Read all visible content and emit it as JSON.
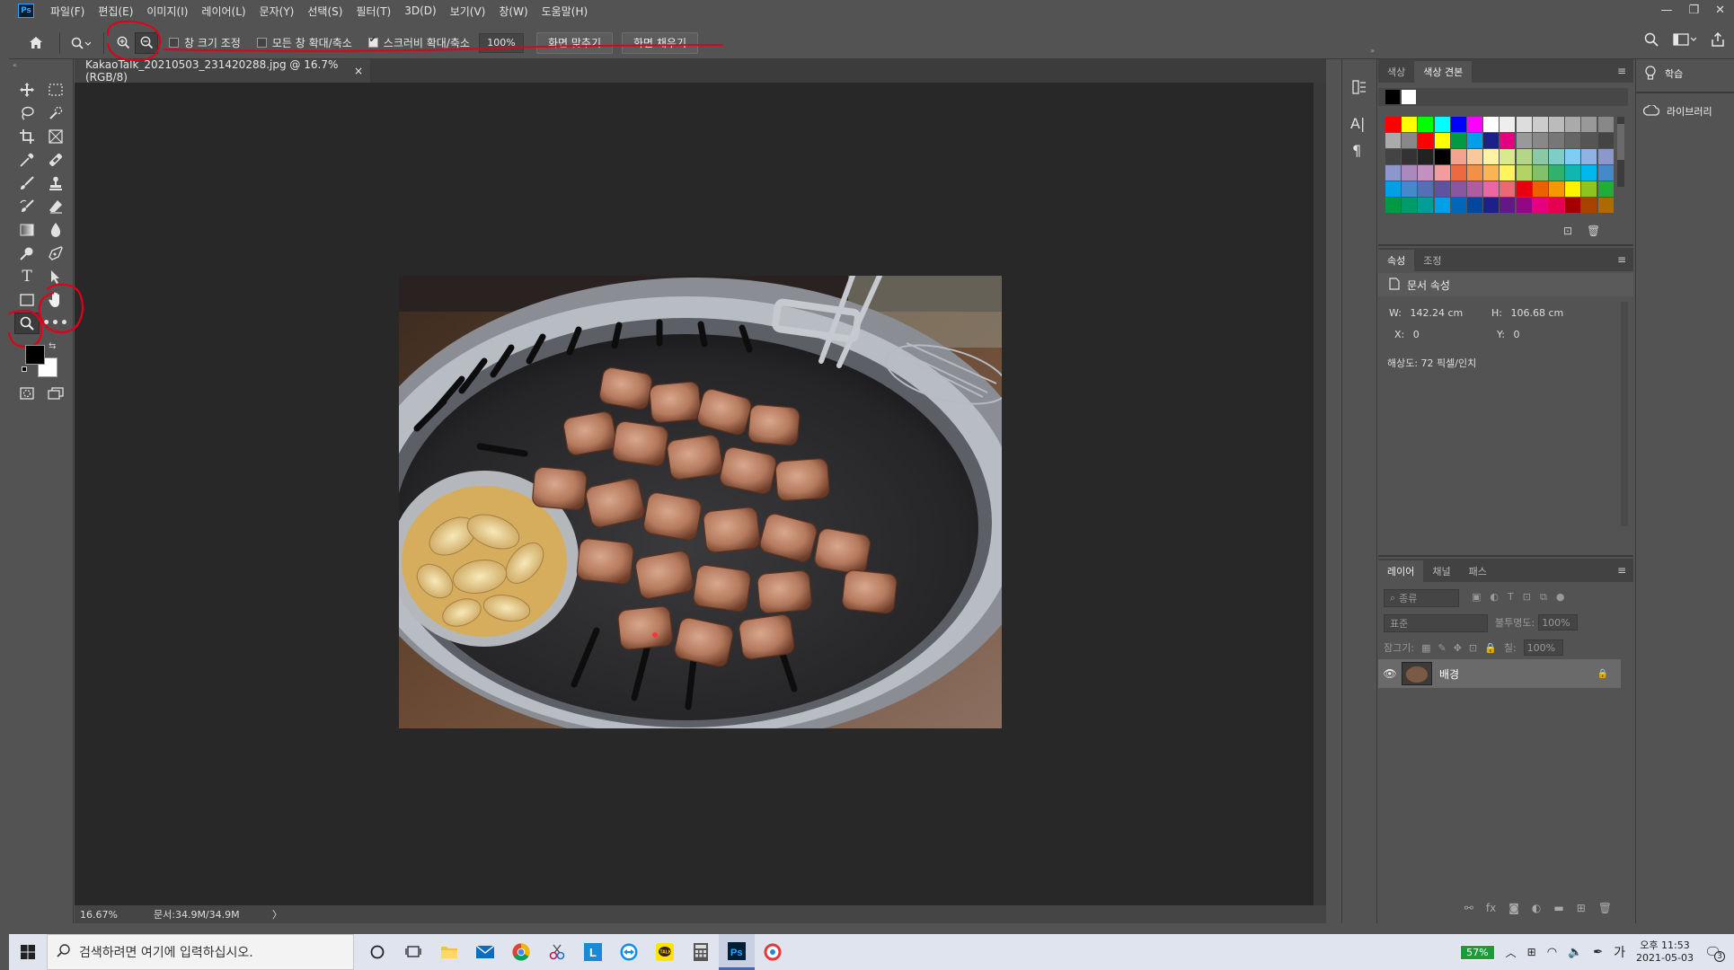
{
  "menubar": {
    "logo": "Ps",
    "items": [
      "파일(F)",
      "편집(E)",
      "이미지(I)",
      "레이어(L)",
      "문자(Y)",
      "선택(S)",
      "필터(T)",
      "3D(D)",
      "보기(V)",
      "창(W)",
      "도움말(H)"
    ],
    "window_controls": [
      "—",
      "❐",
      "✕"
    ]
  },
  "options": {
    "resize_windows": "창 크기 조정",
    "zoom_all_windows": "모든 창 확대/축소",
    "scrubby_zoom": "스크러비 확대/축소",
    "zoom_value": "100%",
    "fit_screen": "화면 맞추기",
    "fill_screen": "화면 채우기"
  },
  "document": {
    "tab_title": "KakaoTalk_20210503_231420288.jpg @ 16.7% (RGB/8)",
    "tab_close": "×",
    "status_zoom": "16.67%",
    "status_doc": "문서:34.9M/34.9M",
    "status_arrow": "〉"
  },
  "color_panel": {
    "tabs": [
      "색상",
      "색상 견본"
    ]
  },
  "properties_panel": {
    "tabs": [
      "속성",
      "조정"
    ],
    "heading": "문서 속성",
    "w_label": "W:",
    "w_value": "142.24 cm",
    "h_label": "H:",
    "h_value": "106.68 cm",
    "x_label": "X:",
    "x_value": "0",
    "y_label": "Y:",
    "y_value": "0",
    "resolution": "해상도: 72 픽셀/인치"
  },
  "layers_panel": {
    "tabs": [
      "레이어",
      "채널",
      "패스"
    ],
    "filter_kind": "종류",
    "blend_mode": "표준",
    "opacity_label": "불투명도:",
    "opacity_value": "100%",
    "lock_label": "잠그기:",
    "fill_label": "칠:",
    "fill_value": "100%",
    "layer_name": "배경"
  },
  "side_panel": {
    "learn": "학습",
    "libraries": "라이브러리"
  },
  "taskbar": {
    "search_placeholder": "검색하려면 여기에 입력하십시오.",
    "battery": "57%",
    "ime": "가",
    "time": "오후 11:53",
    "date": "2021-05-03",
    "notification_count": "3"
  },
  "colors": {
    "ui_bg": "#535353",
    "canvas_bg": "#282828",
    "annotation_red": "#e0001a",
    "ps_blue": "#31a8ff"
  },
  "swatches": [
    [
      "#000000",
      "#ffffff"
    ],
    [
      "#ff0000",
      "#ffff00",
      "#00ff00",
      "#00ffff",
      "#0000ff",
      "#ff00ff",
      "#ffffff",
      "#eeeeee",
      "#dddddd",
      "#cccccc",
      "#bbbbbb",
      "#aaaaaa",
      "#999999",
      "#888888"
    ],
    [
      "#aaaaaa",
      "#888888",
      "#ff0000",
      "#ffff00",
      "#009944",
      "#00a0e9",
      "#1d2088",
      "#e4007f",
      "#999999",
      "#888888",
      "#777777",
      "#666666",
      "#555555",
      "#444444"
    ],
    [
      "#444444",
      "#333333",
      "#222222",
      "#000000",
      "#f5a28f",
      "#f9c89b",
      "#fff2a2",
      "#d9e98b",
      "#b3d68b",
      "#8acaa2",
      "#7fcdc7",
      "#7ecef4",
      "#8fb4e3",
      "#8c97cb"
    ],
    [
      "#8c97cb",
      "#aa89bd",
      "#c490bf",
      "#f29c9f",
      "#ec6941",
      "#f19149",
      "#f8b551",
      "#fff45c",
      "#b3d465",
      "#80c269",
      "#32b16c",
      "#13b5b1",
      "#00b7ee",
      "#448aca"
    ],
    [
      "#00a0e9",
      "#448aca",
      "#556fb5",
      "#5f52a0",
      "#8957a1",
      "#ae5da1",
      "#ea68a2",
      "#eb6877",
      "#e60012",
      "#eb6100",
      "#f39800",
      "#fff100",
      "#8fc31f",
      "#22ac38"
    ],
    [
      "#009944",
      "#009b6b",
      "#009e96",
      "#00a0e9",
      "#0068b7",
      "#00479d",
      "#1d2088",
      "#601986",
      "#920783",
      "#e4007f",
      "#e5004f",
      "#a40000",
      "#a84200",
      "#ac6a00"
    ]
  ]
}
